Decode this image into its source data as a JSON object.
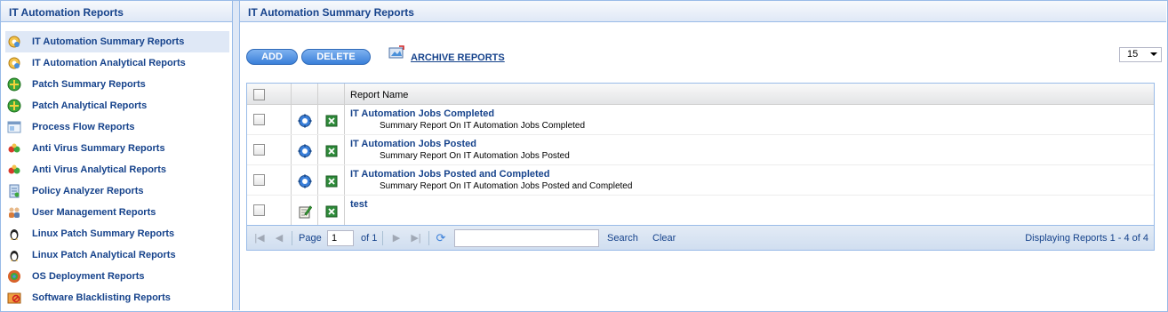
{
  "sidebar": {
    "title": "IT Automation Reports",
    "items": [
      {
        "label": "IT Automation Summary Reports",
        "icon": "automation-icon",
        "selected": true
      },
      {
        "label": "IT Automation Analytical Reports",
        "icon": "automation-icon",
        "selected": false
      },
      {
        "label": "Patch Summary Reports",
        "icon": "patch-icon",
        "selected": false
      },
      {
        "label": "Patch Analytical Reports",
        "icon": "patch-icon",
        "selected": false
      },
      {
        "label": "Process Flow Reports",
        "icon": "process-flow-icon",
        "selected": false
      },
      {
        "label": "Anti Virus Summary Reports",
        "icon": "antivirus-icon",
        "selected": false
      },
      {
        "label": "Anti Virus Analytical Reports",
        "icon": "antivirus-icon",
        "selected": false
      },
      {
        "label": "Policy Analyzer Reports",
        "icon": "policy-icon",
        "selected": false
      },
      {
        "label": "User Management Reports",
        "icon": "users-icon",
        "selected": false
      },
      {
        "label": "Linux Patch Summary Reports",
        "icon": "linux-icon",
        "selected": false
      },
      {
        "label": "Linux Patch Analytical Reports",
        "icon": "linux-icon",
        "selected": false
      },
      {
        "label": "OS Deployment Reports",
        "icon": "os-deploy-icon",
        "selected": false
      },
      {
        "label": "Software Blacklisting Reports",
        "icon": "blacklist-icon",
        "selected": false
      }
    ]
  },
  "main": {
    "title": "IT Automation Summary Reports",
    "toolbar": {
      "add_label": "ADD",
      "delete_label": "DELETE",
      "archive_label": "ARCHIVE REPORTS",
      "page_size": "15"
    },
    "grid": {
      "column_name": "Report Name",
      "rows": [
        {
          "title": "IT Automation Jobs Completed",
          "desc": "Summary Report On IT Automation Jobs Completed",
          "icon": "gear-icon"
        },
        {
          "title": "IT Automation Jobs Posted",
          "desc": "Summary Report On IT Automation Jobs Posted",
          "icon": "gear-icon"
        },
        {
          "title": "IT Automation Jobs Posted and Completed",
          "desc": "Summary Report On IT Automation Jobs Posted and Completed",
          "icon": "gear-icon"
        },
        {
          "title": "test",
          "desc": "",
          "icon": "edit-icon"
        }
      ]
    },
    "pager": {
      "page_label": "Page",
      "page_value": "1",
      "of_label": "of 1",
      "search_label": "Search",
      "clear_label": "Clear",
      "display_text": "Displaying Reports 1 - 4 of 4"
    }
  },
  "colors": {
    "accent": "#15428b",
    "border": "#99bbe8",
    "selected_bg": "#dfe8f6",
    "button": "#3a7fd9"
  }
}
